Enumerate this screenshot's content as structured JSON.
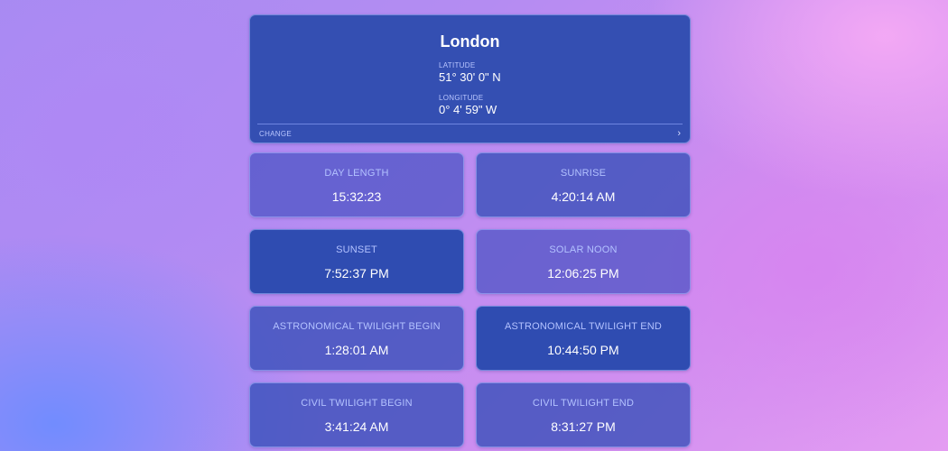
{
  "location": {
    "city": "London",
    "latitude_label": "LATITUDE",
    "latitude_value": "51° 30' 0\" N",
    "longitude_label": "LONGITUDE",
    "longitude_value": "0° 4' 59\" W",
    "change_label": "CHANGE",
    "chevron_glyph": "›"
  },
  "tiles": [
    {
      "label": "DAY LENGTH",
      "value": "15:32:23"
    },
    {
      "label": "SUNRISE",
      "value": "4:20:14 AM"
    },
    {
      "label": "SUNSET",
      "value": "7:52:37 PM"
    },
    {
      "label": "SOLAR NOON",
      "value": "12:06:25 PM"
    },
    {
      "label": "ASTRONOMICAL TWILIGHT BEGIN",
      "value": "1:28:01 AM"
    },
    {
      "label": "ASTRONOMICAL TWILIGHT END",
      "value": "10:44:50 PM"
    },
    {
      "label": "CIVIL TWILIGHT BEGIN",
      "value": "3:41:24 AM"
    },
    {
      "label": "CIVIL TWILIGHT END",
      "value": "8:31:27 PM"
    }
  ],
  "colors": {
    "card": "#344fb2",
    "label": "#b3c2ff",
    "value": "#ffffff"
  },
  "icons": {
    "change": "chevron-right-icon"
  }
}
